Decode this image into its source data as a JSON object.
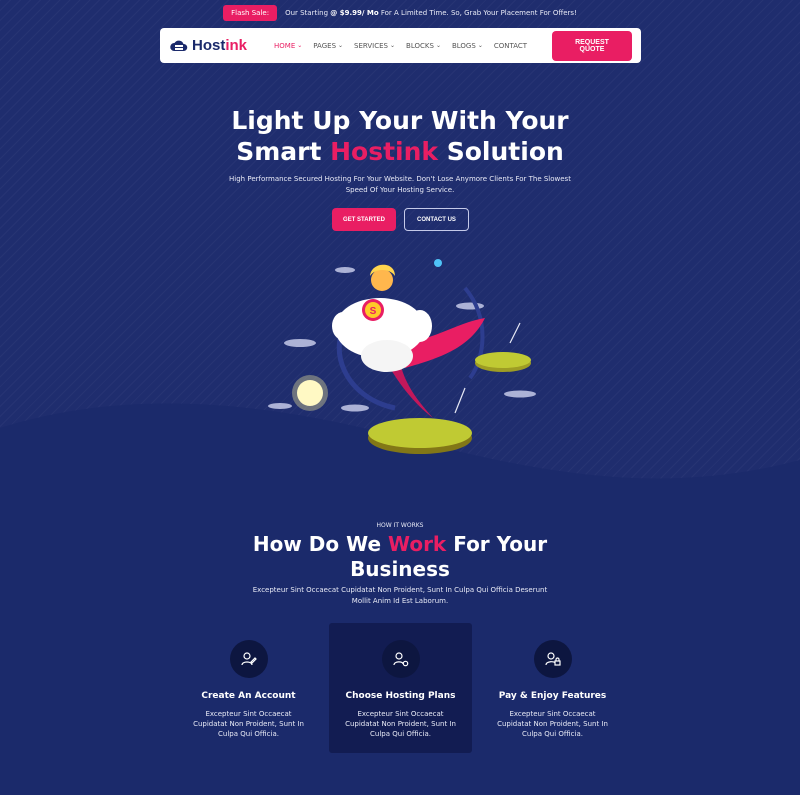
{
  "topbar": {
    "badge": "Flash Sale:",
    "text_prefix": "Our Starting",
    "price": "@ $9.99/ Mo",
    "text_suffix": "For A Limited Time. So, Grab Your Placement For Offers!"
  },
  "brand": {
    "name_main": "Host",
    "name_accent": "ink"
  },
  "nav": {
    "items": [
      {
        "label": "HOME",
        "has_caret": true
      },
      {
        "label": "PAGES",
        "has_caret": true
      },
      {
        "label": "SERVICES",
        "has_caret": true
      },
      {
        "label": "BLOCKS",
        "has_caret": true
      },
      {
        "label": "BLOGS",
        "has_caret": true
      },
      {
        "label": "CONTACT",
        "has_caret": false
      }
    ],
    "cta": "REQUEST QUOTE"
  },
  "hero": {
    "title_line1": "Light Up Your With Your",
    "title_line2_start": "Smart ",
    "title_line2_accent": "Hostink",
    "title_line2_end": " Solution",
    "subtitle": "High Performance Secured Hosting For Your Website. Don't Lose Anymore Clients For The Slowest Speed Of Your Hosting Service.",
    "primary_button": "GET STARTED",
    "secondary_button": "CONTACT US",
    "illustration_badge_letter": "S"
  },
  "how": {
    "eyebrow": "HOW IT WORKS",
    "title_start": "How Do We ",
    "title_accent": "Work",
    "title_end": " For Your",
    "title_line2": "Business",
    "subtitle": "Excepteur Sint Occaecat Cupidatat Non Proident, Sunt In Culpa Qui Officia Deserunt Mollit Anim Id Est Laborum.",
    "cards": [
      {
        "title": "Create An Account",
        "text": "Excepteur Sint Occaecat Cupidatat Non Proident, Sunt In Culpa Qui Officia.",
        "icon": "user-edit-icon"
      },
      {
        "title": "Choose Hosting Plans",
        "text": "Excepteur Sint Occaecat Cupidatat Non Proident, Sunt In Culpa Qui Officia.",
        "icon": "user-settings-icon"
      },
      {
        "title": "Pay & Enjoy Features",
        "text": "Excepteur Sint Occaecat Cupidatat Non Proident, Sunt In Culpa Qui Officia.",
        "icon": "user-lock-icon"
      }
    ]
  },
  "colors": {
    "accent": "#e91e63",
    "background": "#1b2a6b",
    "hero_background": "#1f2d6e",
    "card_highlight": "#121c52"
  }
}
